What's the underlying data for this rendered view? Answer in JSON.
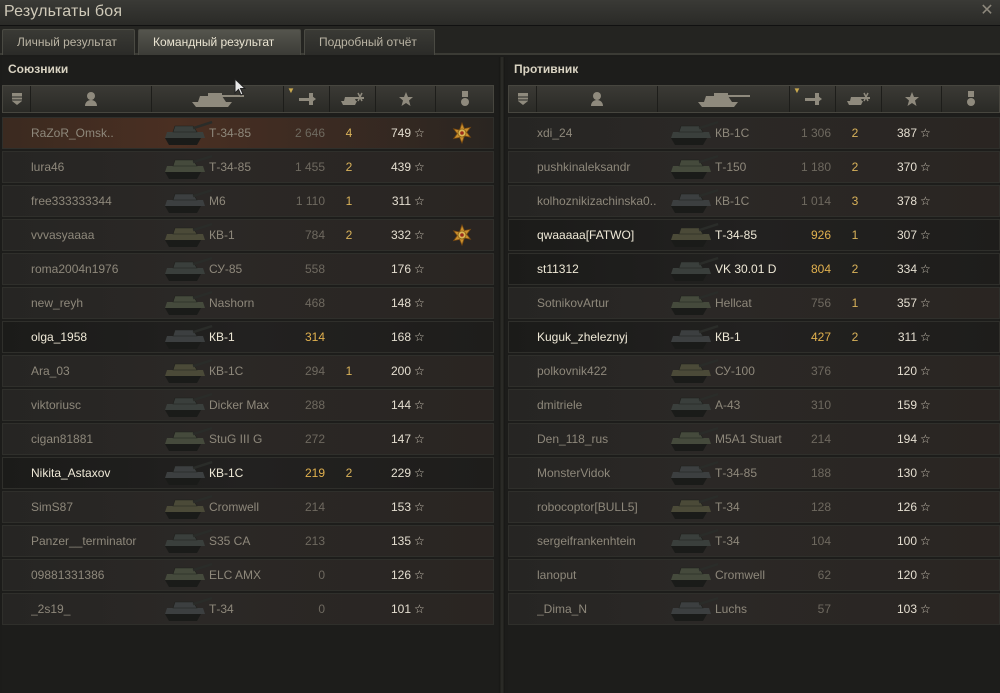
{
  "window": {
    "title": "Результаты боя",
    "close_glyph": "✕"
  },
  "tabs": [
    {
      "label": "Личный результат"
    },
    {
      "label": "Командный результат",
      "active": true
    },
    {
      "label": "Подробный отчёт"
    }
  ],
  "columns": [
    {
      "icon": "rank-icon"
    },
    {
      "icon": "player-icon"
    },
    {
      "icon": "vehicle-icon"
    },
    {
      "icon": "damage-icon",
      "sorted": true
    },
    {
      "icon": "frags-icon"
    },
    {
      "icon": "experience-icon"
    },
    {
      "icon": "medal-icon"
    }
  ],
  "allies": {
    "title": "Союзники",
    "rows": [
      {
        "name": "RaZoR_Omsk..",
        "vehicle": "Т-34-85",
        "damage": "2 646",
        "kills": "4",
        "xp": "749",
        "medal": true,
        "style": "hl"
      },
      {
        "name": "lura46",
        "vehicle": "Т-34-85",
        "damage": "1 455",
        "kills": "2",
        "xp": "439"
      },
      {
        "name": "free333333344",
        "vehicle": "M6",
        "damage": "1 110",
        "kills": "1",
        "xp": "311"
      },
      {
        "name": "vvvasyaaaa",
        "vehicle": "КВ-1",
        "damage": "784",
        "kills": "2",
        "xp": "332",
        "medal": true
      },
      {
        "name": "roma2004n1976",
        "vehicle": "СУ-85",
        "damage": "558",
        "kills": "",
        "xp": "176"
      },
      {
        "name": "new_reyh",
        "vehicle": "Nashorn",
        "damage": "468",
        "kills": "",
        "xp": "148"
      },
      {
        "name": "olga_1958",
        "vehicle": "КВ-1",
        "damage": "314",
        "kills": "",
        "xp": "168",
        "alive": true,
        "style": "dark"
      },
      {
        "name": "Ara_03",
        "vehicle": "КВ-1С",
        "damage": "294",
        "kills": "1",
        "xp": "200"
      },
      {
        "name": "viktoriusc",
        "vehicle": "Dicker Max",
        "damage": "288",
        "kills": "",
        "xp": "144"
      },
      {
        "name": "cigan81881",
        "vehicle": "StuG III G",
        "damage": "272",
        "kills": "",
        "xp": "147"
      },
      {
        "name": "Nikita_Astaxov",
        "vehicle": "КВ-1С",
        "damage": "219",
        "kills": "2",
        "xp": "229",
        "alive": true,
        "style": "dark"
      },
      {
        "name": "SimS87",
        "vehicle": "Cromwell",
        "damage": "214",
        "kills": "",
        "xp": "153"
      },
      {
        "name": "Panzer__terminator",
        "vehicle": "S35 CA",
        "damage": "213",
        "kills": "",
        "xp": "135"
      },
      {
        "name": "09881331386",
        "vehicle": "ELC AMX",
        "damage": "0",
        "kills": "",
        "xp": "126"
      },
      {
        "name": "_2s19_",
        "vehicle": "Т-34",
        "damage": "0",
        "kills": "",
        "xp": "101"
      }
    ]
  },
  "enemies": {
    "title": "Противник",
    "rows": [
      {
        "name": "xdi_24",
        "vehicle": "КВ-1С",
        "damage": "1 306",
        "kills": "2",
        "xp": "387"
      },
      {
        "name": "pushkinaleksandr",
        "vehicle": "Т-150",
        "damage": "1 180",
        "kills": "2",
        "xp": "370"
      },
      {
        "name": "kolhoznikizachinska0..",
        "vehicle": "КВ-1С",
        "damage": "1 014",
        "kills": "3",
        "xp": "378"
      },
      {
        "name": "qwaaaaa[FATWO]",
        "vehicle": "Т-34-85",
        "damage": "926",
        "kills": "1",
        "xp": "307",
        "alive": true,
        "style": "dark"
      },
      {
        "name": "st11312",
        "vehicle": "VK 30.01 D",
        "damage": "804",
        "kills": "2",
        "xp": "334",
        "alive": true,
        "style": "dark"
      },
      {
        "name": "SotnikovArtur",
        "vehicle": "Hellcat",
        "damage": "756",
        "kills": "1",
        "xp": "357"
      },
      {
        "name": "Kuguk_zheleznyj",
        "vehicle": "КВ-1",
        "damage": "427",
        "kills": "2",
        "xp": "311",
        "alive": true,
        "style": "dark"
      },
      {
        "name": "polkovnik422",
        "vehicle": "СУ-100",
        "damage": "376",
        "kills": "",
        "xp": "120"
      },
      {
        "name": "dmitriele",
        "vehicle": "А-43",
        "damage": "310",
        "kills": "",
        "xp": "159"
      },
      {
        "name": "Den_118_rus",
        "vehicle": "M5A1 Stuart",
        "damage": "214",
        "kills": "",
        "xp": "194"
      },
      {
        "name": "MonsterVidok",
        "vehicle": "Т-34-85",
        "damage": "188",
        "kills": "",
        "xp": "130"
      },
      {
        "name": "robocoptor[BULL5]",
        "vehicle": "Т-34",
        "damage": "128",
        "kills": "",
        "xp": "126"
      },
      {
        "name": "sergeifrankenhtein",
        "vehicle": "Т-34",
        "damage": "104",
        "kills": "",
        "xp": "100"
      },
      {
        "name": "lanoput",
        "vehicle": "Cromwell",
        "damage": "62",
        "kills": "",
        "xp": "120"
      },
      {
        "name": "_Dima_N",
        "vehicle": "Luchs",
        "damage": "57",
        "kills": "",
        "xp": "103"
      }
    ]
  },
  "xp_star_glyph": "☆",
  "colors": {
    "accent_gold": "#e0b04e",
    "alive_text": "#efe9d7",
    "dead_text": "#8e887b"
  }
}
